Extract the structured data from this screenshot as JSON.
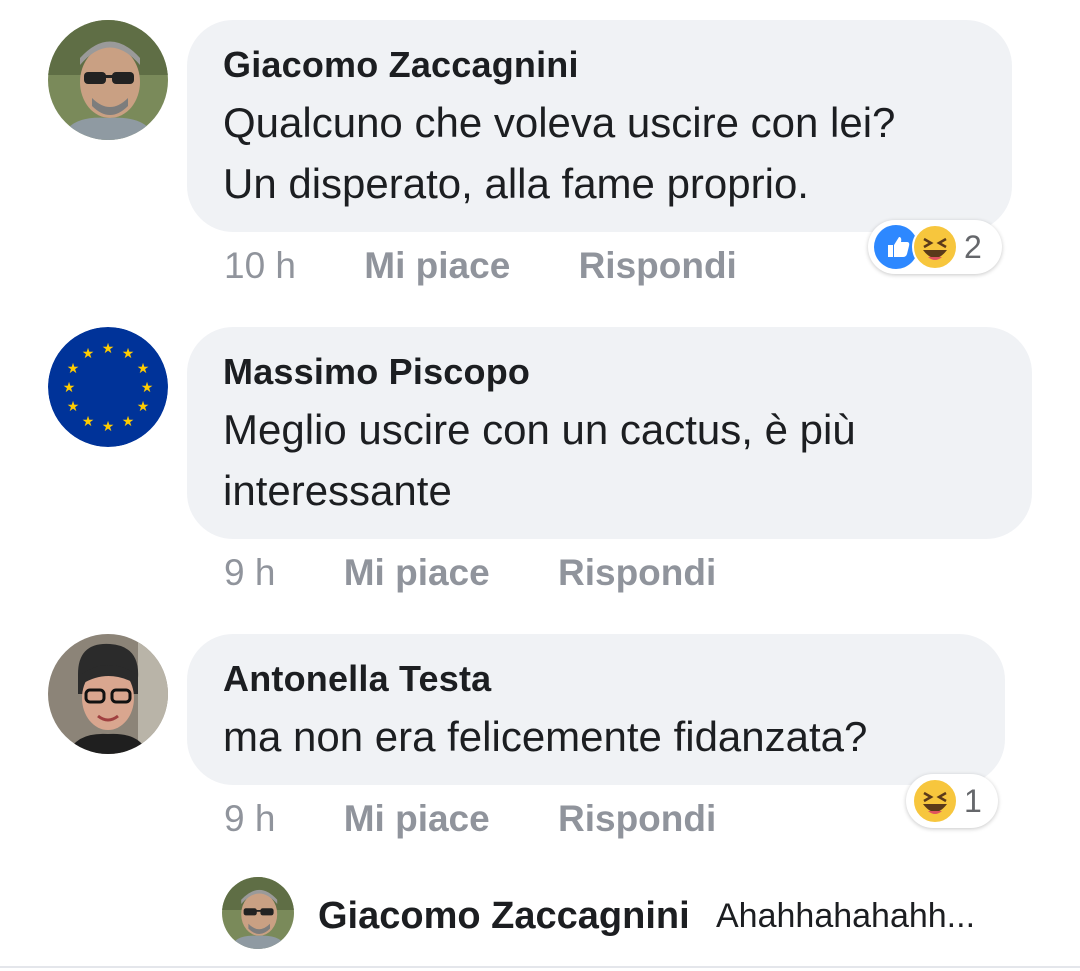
{
  "comments": [
    {
      "author": "Giacomo Zaccagnini",
      "text_line1": "Qualcuno che voleva uscire con lei?",
      "text_line2": "Un disperato, alla fame proprio.",
      "time": "10 h",
      "like_label": "Mi piace",
      "reply_label": "Rispondi",
      "reactions": [
        "like",
        "haha"
      ],
      "reaction_count": "2"
    },
    {
      "author": "Massimo Piscopo",
      "text_line1": "Meglio uscire con un cactus, è più",
      "text_line2": "interessante",
      "time": "9 h",
      "like_label": "Mi piace",
      "reply_label": "Rispondi"
    },
    {
      "author": "Antonella Testa",
      "text_line1": "ma non era felicemente fidanzata?",
      "time": "9 h",
      "like_label": "Mi piace",
      "reply_label": "Rispondi",
      "reactions": [
        "haha"
      ],
      "reaction_count": "1"
    }
  ],
  "reply_preview": {
    "author": "Giacomo Zaccagnini",
    "text": "Ahahhahahahh..."
  },
  "colors": {
    "bubble_bg": "#f0f2f5",
    "meta_text": "#90949c",
    "like_blue": "#2d88ff",
    "haha_yellow": "#f7c63d",
    "eu_blue": "#003399",
    "eu_star": "#ffcc00"
  }
}
